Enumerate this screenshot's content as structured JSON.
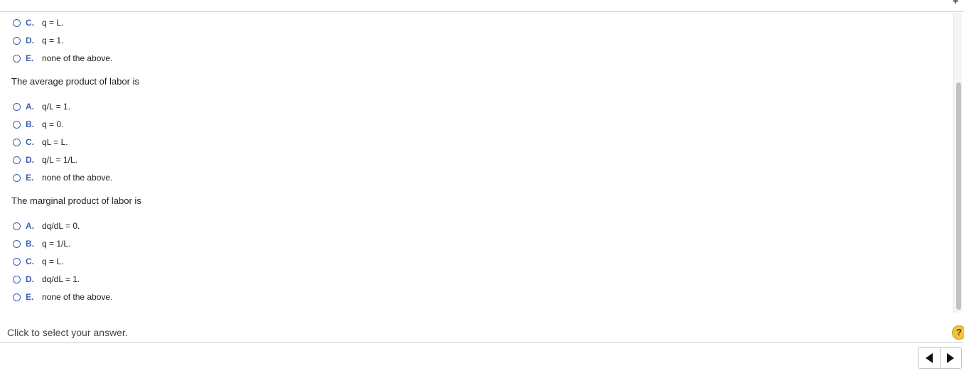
{
  "question_prev": {
    "options": [
      {
        "letter": "C.",
        "text": "q = L."
      },
      {
        "letter": "D.",
        "text": "q = 1."
      },
      {
        "letter": "E.",
        "text": "none of the above."
      }
    ]
  },
  "question_apl": {
    "prompt": "The average product of labor is",
    "options": [
      {
        "letter": "A.",
        "text": "q/L = 1."
      },
      {
        "letter": "B.",
        "text": "q = 0."
      },
      {
        "letter": "C.",
        "text": "qL = L."
      },
      {
        "letter": "D.",
        "text": "q/L = 1/L."
      },
      {
        "letter": "E.",
        "text": "none of the above."
      }
    ]
  },
  "question_mpl": {
    "prompt": "The marginal product of labor is",
    "options": [
      {
        "letter": "A.",
        "text": "dq/dL = 0."
      },
      {
        "letter": "B.",
        "text": "q = 1/L."
      },
      {
        "letter": "C.",
        "text": "q = L."
      },
      {
        "letter": "D.",
        "text": "dq/dL = 1."
      },
      {
        "letter": "E.",
        "text": "none of the above."
      }
    ]
  },
  "footer": {
    "instruction": "Click to select your answer.",
    "help_symbol": "?"
  },
  "icons": {
    "help": "question-mark-icon",
    "prev": "triangle-left-icon",
    "next": "triangle-right-icon",
    "radio": "radio-button-icon"
  },
  "colors": {
    "accent": "#3b5eb7",
    "help_badge": "#f3c33a"
  }
}
